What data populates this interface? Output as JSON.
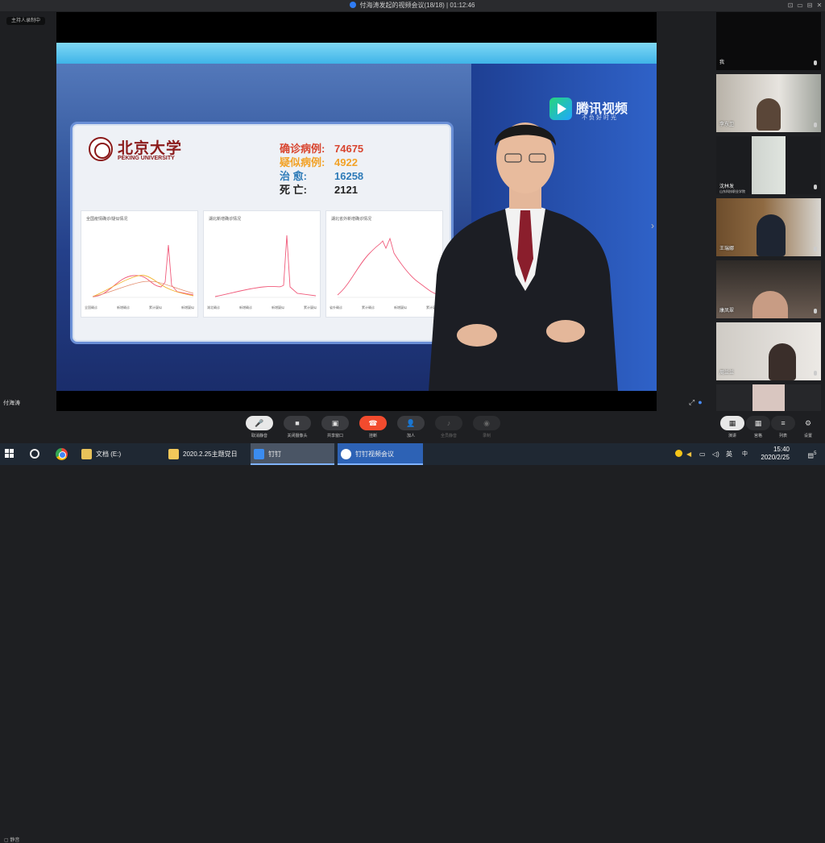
{
  "window": {
    "title": "付海涛发起的视频会议(18/18) | 01:12:46",
    "controls": [
      "⊡",
      "▭",
      "⊟",
      "✕"
    ]
  },
  "recording_badge": "主持人录制中",
  "presenter_name": "付海涛",
  "video": {
    "brand": "腾讯视频",
    "slogan": "不负好时光",
    "university_cn": "北京大学",
    "university_en": "PEKING UNIVERSITY",
    "stats": [
      {
        "label": "确诊病例:",
        "value": "74675"
      },
      {
        "label": "疑似病例:",
        "value": "4922"
      },
      {
        "label": "治 愈:",
        "value": "16258"
      },
      {
        "label": "死 亡:",
        "value": "2121"
      }
    ],
    "charts": [
      {
        "title": "全国疫情确诊/疑似情况",
        "footer": [
          "全国确诊",
          "新增确诊",
          "累计疑似",
          "新增疑似"
        ]
      },
      {
        "title": "湖北新增确诊情况",
        "footer": [
          "湖北确诊",
          "新增确诊",
          "新增疑似",
          "累计疑似"
        ]
      },
      {
        "title": "湖北省外新增确诊情况",
        "footer": [
          "省外确诊",
          "累计确诊",
          "新增疑似",
          "累计疑似"
        ]
      }
    ]
  },
  "participants": [
    {
      "name": "我",
      "sub": ""
    },
    {
      "name": "李东卫",
      "sub": ""
    },
    {
      "name": "沈林发",
      "sub": "山东科技职业学院"
    },
    {
      "name": "王瑞娜",
      "sub": ""
    },
    {
      "name": "康凤翠",
      "sub": ""
    },
    {
      "name": "周兰兰",
      "sub": ""
    },
    {
      "name": "",
      "sub": ""
    }
  ],
  "toolbar": {
    "buttons": [
      {
        "label": "取消静音",
        "icon": "🎤"
      },
      {
        "label": "关闭摄像头",
        "icon": "■"
      },
      {
        "label": "共享窗口",
        "icon": "▣"
      },
      {
        "label": "挂断",
        "icon": "☎"
      },
      {
        "label": "加人",
        "icon": "👤"
      },
      {
        "label": "全员静音",
        "icon": "♪"
      },
      {
        "label": "录制",
        "icon": "◉"
      }
    ],
    "right_buttons": [
      {
        "label": "演讲",
        "icon": "▦"
      },
      {
        "label": "宫格",
        "icon": "▦"
      },
      {
        "label": "列表",
        "icon": "≡"
      },
      {
        "label": "设置",
        "icon": "⚙"
      }
    ],
    "left_mini": "▢ 静音"
  },
  "taskbar": {
    "items": [
      {
        "label": "文档 (E:)",
        "color": "#e8c25a"
      },
      {
        "label": "2020.2.25主题党日",
        "color": "#f2c85a"
      },
      {
        "label": "钉钉",
        "color": "#3b8cf0"
      },
      {
        "label": "钉钉视频会议",
        "color": "#2f7cf6"
      }
    ],
    "ime": "英",
    "ime2": "中",
    "time": "15:40",
    "date": "2020/2/25",
    "notify_count": "5"
  }
}
